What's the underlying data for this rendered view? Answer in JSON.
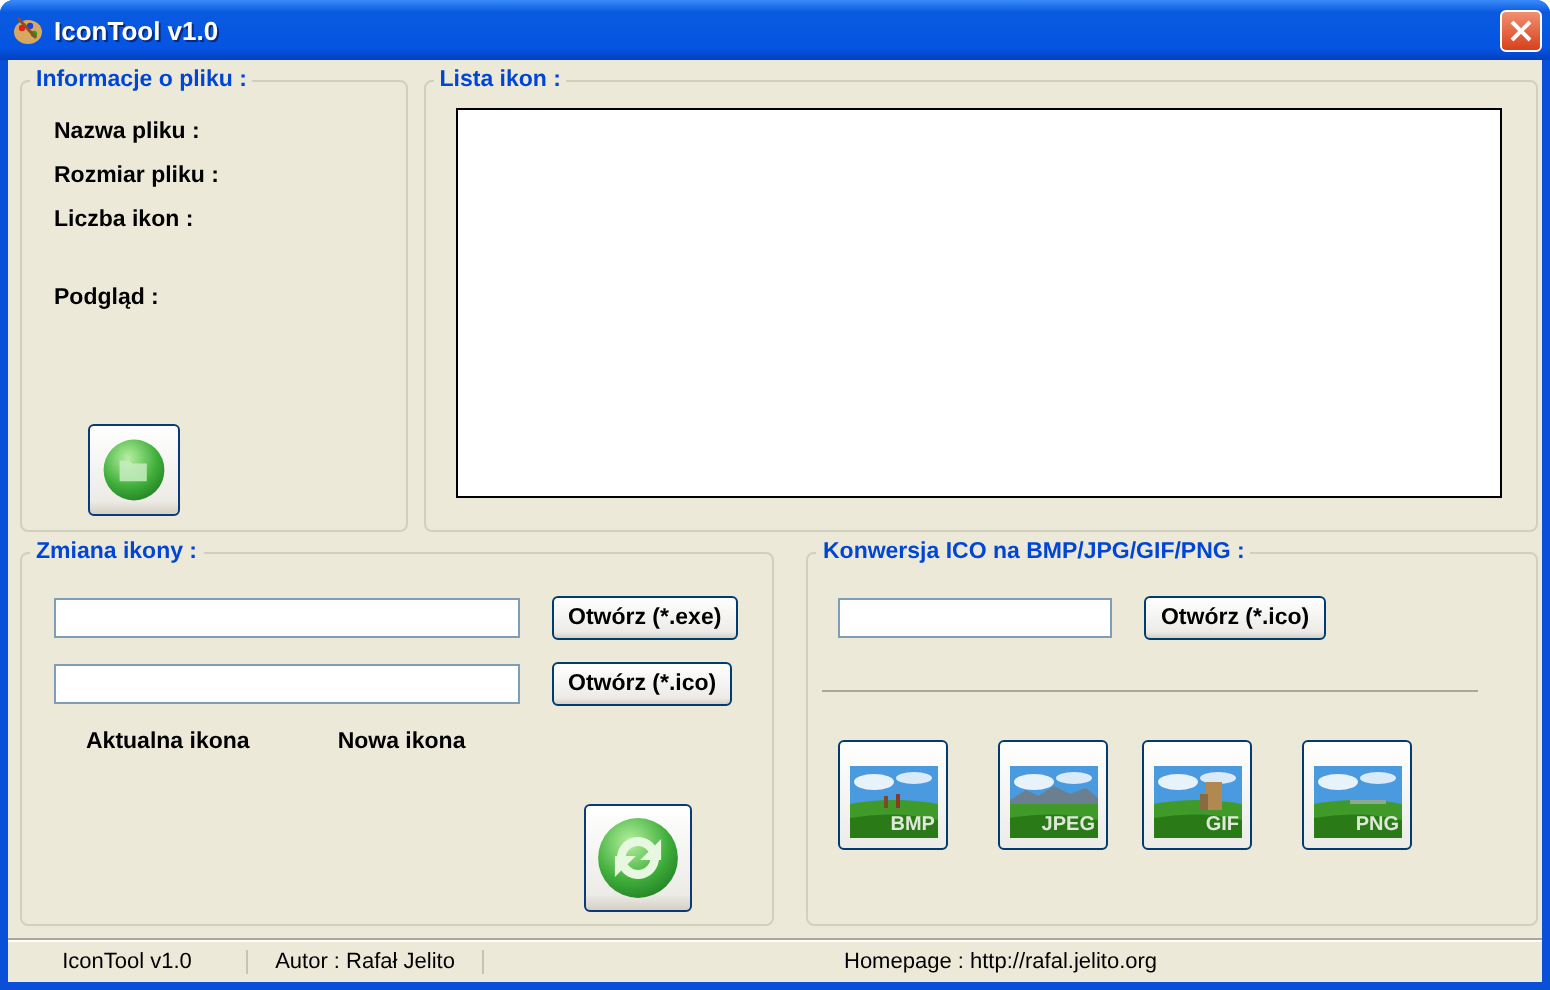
{
  "window": {
    "title": "IconTool v1.0"
  },
  "file_info": {
    "title": "Informacje o pliku :",
    "labels": [
      "Nazwa pliku :",
      "Rozmiar pliku :",
      "Liczba ikon :",
      "Podgląd :"
    ]
  },
  "icon_list": {
    "title": "Lista ikon :"
  },
  "change_icon": {
    "title": "Zmiana ikony :",
    "rows": [
      {
        "button": "Otwórz (*.exe)"
      },
      {
        "button": "Otwórz (*.ico)"
      }
    ],
    "captions": [
      "Aktualna ikona",
      "Nowa ikona"
    ]
  },
  "convert": {
    "title": "Konwersja ICO na BMP/JPG/GIF/PNG :",
    "button": "Otwórz (*.ico)",
    "formats": [
      {
        "label": "BMP",
        "kind": "windmill"
      },
      {
        "label": "JPEG",
        "kind": "mountains"
      },
      {
        "label": "GIF",
        "kind": "tower"
      },
      {
        "label": "PNG",
        "kind": "plain"
      }
    ]
  },
  "status_bar": [
    "IconTool v1.0",
    "Autor : Rafał Jelito",
    "Homepage : http://rafal.jelito.org"
  ]
}
